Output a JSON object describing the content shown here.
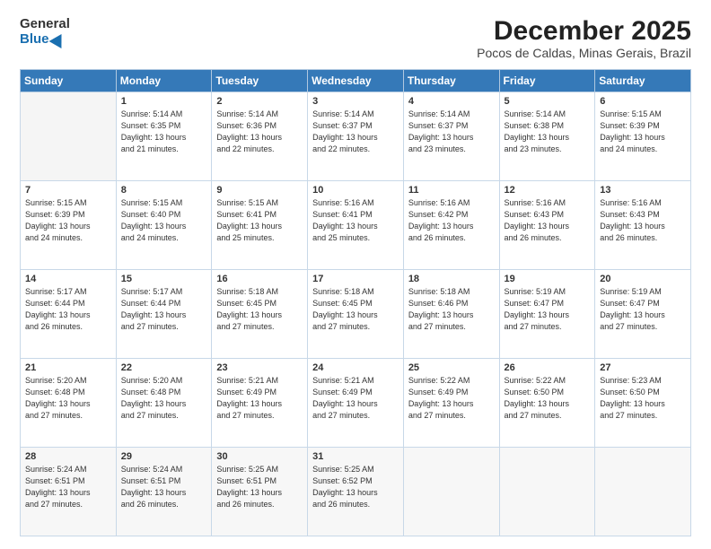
{
  "logo": {
    "general": "General",
    "blue": "Blue"
  },
  "header": {
    "month_year": "December 2025",
    "location": "Pocos de Caldas, Minas Gerais, Brazil"
  },
  "days_of_week": [
    "Sunday",
    "Monday",
    "Tuesday",
    "Wednesday",
    "Thursday",
    "Friday",
    "Saturday"
  ],
  "weeks": [
    [
      {
        "day": "",
        "sunrise": "",
        "sunset": "",
        "daylight": "",
        "empty": true
      },
      {
        "day": "1",
        "sunrise": "5:14 AM",
        "sunset": "6:35 PM",
        "daylight": "13 hours and 21 minutes."
      },
      {
        "day": "2",
        "sunrise": "5:14 AM",
        "sunset": "6:36 PM",
        "daylight": "13 hours and 22 minutes."
      },
      {
        "day": "3",
        "sunrise": "5:14 AM",
        "sunset": "6:37 PM",
        "daylight": "13 hours and 22 minutes."
      },
      {
        "day": "4",
        "sunrise": "5:14 AM",
        "sunset": "6:37 PM",
        "daylight": "13 hours and 23 minutes."
      },
      {
        "day": "5",
        "sunrise": "5:14 AM",
        "sunset": "6:38 PM",
        "daylight": "13 hours and 23 minutes."
      },
      {
        "day": "6",
        "sunrise": "5:15 AM",
        "sunset": "6:39 PM",
        "daylight": "13 hours and 24 minutes."
      }
    ],
    [
      {
        "day": "7",
        "sunrise": "5:15 AM",
        "sunset": "6:39 PM",
        "daylight": "13 hours and 24 minutes."
      },
      {
        "day": "8",
        "sunrise": "5:15 AM",
        "sunset": "6:40 PM",
        "daylight": "13 hours and 24 minutes."
      },
      {
        "day": "9",
        "sunrise": "5:15 AM",
        "sunset": "6:41 PM",
        "daylight": "13 hours and 25 minutes."
      },
      {
        "day": "10",
        "sunrise": "5:16 AM",
        "sunset": "6:41 PM",
        "daylight": "13 hours and 25 minutes."
      },
      {
        "day": "11",
        "sunrise": "5:16 AM",
        "sunset": "6:42 PM",
        "daylight": "13 hours and 26 minutes."
      },
      {
        "day": "12",
        "sunrise": "5:16 AM",
        "sunset": "6:43 PM",
        "daylight": "13 hours and 26 minutes."
      },
      {
        "day": "13",
        "sunrise": "5:16 AM",
        "sunset": "6:43 PM",
        "daylight": "13 hours and 26 minutes."
      }
    ],
    [
      {
        "day": "14",
        "sunrise": "5:17 AM",
        "sunset": "6:44 PM",
        "daylight": "13 hours and 26 minutes."
      },
      {
        "day": "15",
        "sunrise": "5:17 AM",
        "sunset": "6:44 PM",
        "daylight": "13 hours and 27 minutes."
      },
      {
        "day": "16",
        "sunrise": "5:18 AM",
        "sunset": "6:45 PM",
        "daylight": "13 hours and 27 minutes."
      },
      {
        "day": "17",
        "sunrise": "5:18 AM",
        "sunset": "6:45 PM",
        "daylight": "13 hours and 27 minutes."
      },
      {
        "day": "18",
        "sunrise": "5:18 AM",
        "sunset": "6:46 PM",
        "daylight": "13 hours and 27 minutes."
      },
      {
        "day": "19",
        "sunrise": "5:19 AM",
        "sunset": "6:47 PM",
        "daylight": "13 hours and 27 minutes."
      },
      {
        "day": "20",
        "sunrise": "5:19 AM",
        "sunset": "6:47 PM",
        "daylight": "13 hours and 27 minutes."
      }
    ],
    [
      {
        "day": "21",
        "sunrise": "5:20 AM",
        "sunset": "6:48 PM",
        "daylight": "13 hours and 27 minutes."
      },
      {
        "day": "22",
        "sunrise": "5:20 AM",
        "sunset": "6:48 PM",
        "daylight": "13 hours and 27 minutes."
      },
      {
        "day": "23",
        "sunrise": "5:21 AM",
        "sunset": "6:49 PM",
        "daylight": "13 hours and 27 minutes."
      },
      {
        "day": "24",
        "sunrise": "5:21 AM",
        "sunset": "6:49 PM",
        "daylight": "13 hours and 27 minutes."
      },
      {
        "day": "25",
        "sunrise": "5:22 AM",
        "sunset": "6:49 PM",
        "daylight": "13 hours and 27 minutes."
      },
      {
        "day": "26",
        "sunrise": "5:22 AM",
        "sunset": "6:50 PM",
        "daylight": "13 hours and 27 minutes."
      },
      {
        "day": "27",
        "sunrise": "5:23 AM",
        "sunset": "6:50 PM",
        "daylight": "13 hours and 27 minutes."
      }
    ],
    [
      {
        "day": "28",
        "sunrise": "5:24 AM",
        "sunset": "6:51 PM",
        "daylight": "13 hours and 27 minutes."
      },
      {
        "day": "29",
        "sunrise": "5:24 AM",
        "sunset": "6:51 PM",
        "daylight": "13 hours and 26 minutes."
      },
      {
        "day": "30",
        "sunrise": "5:25 AM",
        "sunset": "6:51 PM",
        "daylight": "13 hours and 26 minutes."
      },
      {
        "day": "31",
        "sunrise": "5:25 AM",
        "sunset": "6:52 PM",
        "daylight": "13 hours and 26 minutes."
      },
      {
        "day": "",
        "sunrise": "",
        "sunset": "",
        "daylight": "",
        "empty": true
      },
      {
        "day": "",
        "sunrise": "",
        "sunset": "",
        "daylight": "",
        "empty": true
      },
      {
        "day": "",
        "sunrise": "",
        "sunset": "",
        "daylight": "",
        "empty": true
      }
    ]
  ],
  "labels": {
    "sunrise": "Sunrise:",
    "sunset": "Sunset:",
    "daylight": "Daylight:"
  }
}
